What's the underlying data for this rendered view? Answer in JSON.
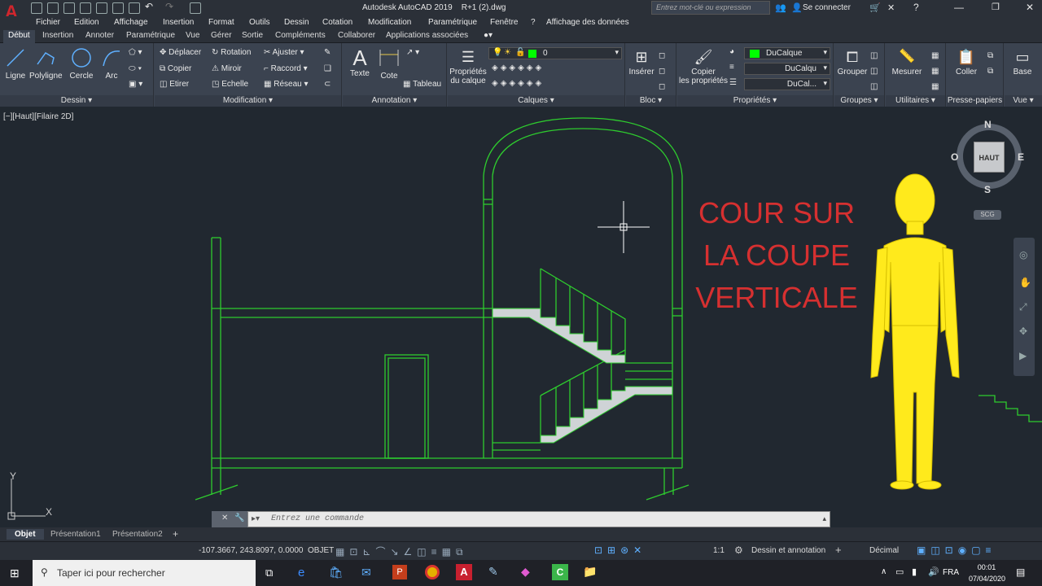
{
  "title": "Autodesk AutoCAD 2019    R+1 (2).dwg",
  "search_placeholder": "Entrez mot-clé ou expression",
  "connect": "Se connecter",
  "menus": [
    "Fichier",
    "Edition",
    "Affichage",
    "Insertion",
    "Format",
    "Outils",
    "Dessin",
    "Cotation",
    "Modification",
    "Paramétrique",
    "Fenêtre",
    "?",
    "Affichage des données"
  ],
  "tabs": [
    "Début",
    "Insertion",
    "Annoter",
    "Paramétrique",
    "Vue",
    "Gérer",
    "Sortie",
    "Compléments",
    "Collaborer",
    "Applications associées"
  ],
  "draw": {
    "title": "Dessin",
    "ligne": "Ligne",
    "polyligne": "Polyligne",
    "cercle": "Cercle",
    "arc": "Arc"
  },
  "modify": {
    "title": "Modification",
    "deplacer": "Déplacer",
    "rotation": "Rotation",
    "ajuster": "Ajuster",
    "copier": "Copier",
    "miroir": "Miroir",
    "raccord": "Raccord",
    "etirer": "Etirer",
    "echelle": "Echelle",
    "reseau": "Réseau"
  },
  "annotation": {
    "title": "Annotation",
    "texte": "Texte",
    "cote": "Cote",
    "tableau": "Tableau"
  },
  "layers": {
    "title": "Calques",
    "props": "Propriétés\ndu calque",
    "current": "0"
  },
  "bloc": {
    "title": "Bloc",
    "inserer": "Insérer"
  },
  "props": {
    "title": "Propriétés",
    "copier": "Copier\nles propriétés",
    "c1": "DuCalque",
    "c2": "DuCalqu",
    "c3": "DuCal..."
  },
  "groupes": {
    "title": "Groupes",
    "grouper": "Grouper"
  },
  "utilitaires": {
    "title": "Utilitaires",
    "mesurer": "Mesurer"
  },
  "presse": {
    "title": "Presse-papiers",
    "coller": "Coller"
  },
  "vue": {
    "title": "Vue",
    "base": "Base"
  },
  "viewport_label": "[−][Haut][Filaire 2D]",
  "annotation_text": [
    "COUR SUR",
    "LA COUPE",
    "VERTICALE"
  ],
  "viewcube": {
    "n": "N",
    "s": "S",
    "e": "E",
    "o": "O",
    "face": "HAUT",
    "scg": "SCG"
  },
  "ucs": {
    "x": "X",
    "y": "Y"
  },
  "command_placeholder": "Entrez une commande",
  "layout_tabs": [
    "Objet",
    "Présentation1",
    "Présentation2"
  ],
  "coords": "-107.3667, 243.8097, 0.0000",
  "objet_mode": "OBJET",
  "workspace": "Dessin et annotation",
  "scale": "1:1",
  "units": "Décimal",
  "taskbar_search": "Taper ici pour rechercher",
  "lang": "FRA",
  "time": "00:01",
  "date": "07/04/2020",
  "colors": {
    "line": "#2ecc2e",
    "annotation": "#d63030",
    "figure": "#ffea1c"
  }
}
